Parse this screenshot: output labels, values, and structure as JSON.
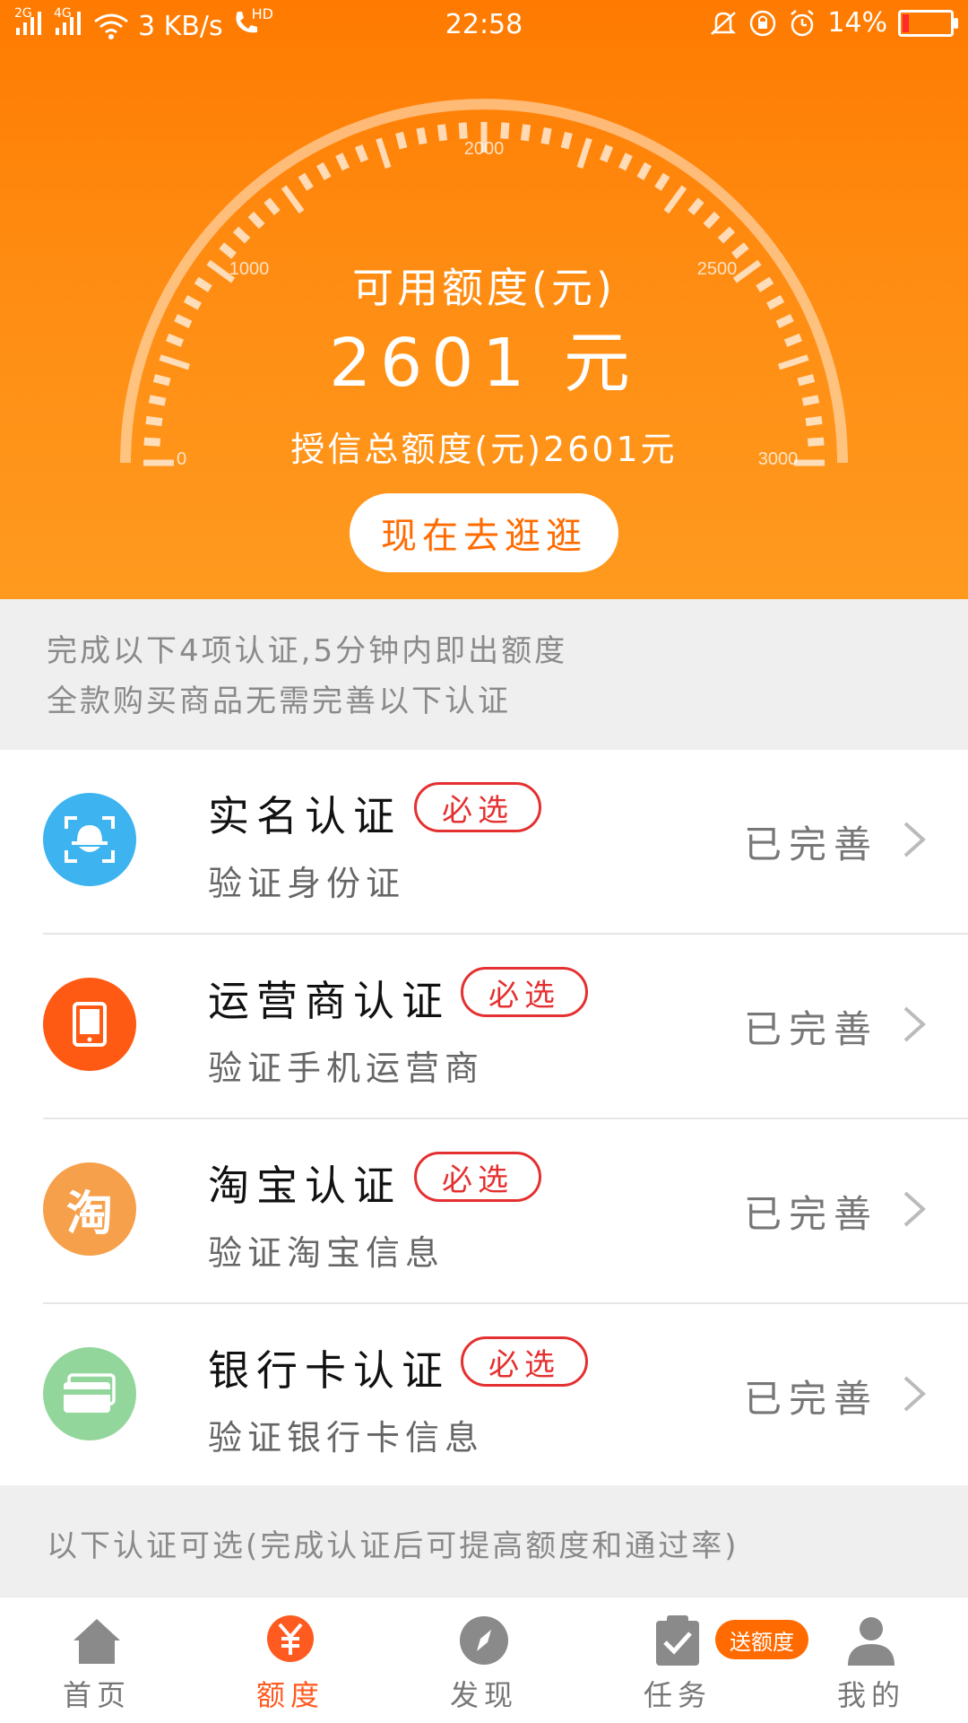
{
  "status_bar": {
    "signal_labels": [
      "2G",
      "4G"
    ],
    "net_speed": "3 KB/s",
    "hd": "HD",
    "time": "22:58",
    "battery": "14%",
    "battery_level": 0.14
  },
  "gauge": {
    "ticks": [
      "0",
      "1000",
      "2000",
      "2500",
      "3000"
    ],
    "title": "可用额度(元)",
    "amount": "2601 元",
    "total": "授信总额度(元)2601元"
  },
  "cta": {
    "label": "现在去逛逛"
  },
  "notice": {
    "line1": "完成以下4项认证,5分钟内即出额度",
    "line2": "全款购买商品无需完善以下认证"
  },
  "verifications": [
    {
      "name": "实名认证",
      "badge": "必选",
      "desc": "验证身份证",
      "status": "已完善",
      "icon": "face-id-icon",
      "color": "#3db3ef"
    },
    {
      "name": "运营商认证",
      "badge": "必选",
      "desc": "验证手机运营商",
      "status": "已完善",
      "icon": "phone-icon",
      "color": "#ff5a14"
    },
    {
      "name": "淘宝认证",
      "badge": "必选",
      "desc": "验证淘宝信息",
      "status": "已完善",
      "icon": "taobao-icon",
      "icon_text": "淘",
      "color": "#f7a04b"
    },
    {
      "name": "银行卡认证",
      "badge": "必选",
      "desc": "验证银行卡信息",
      "status": "已完善",
      "icon": "bank-card-icon",
      "color": "#92d69b"
    }
  ],
  "optional_note": "以下认证可选(完成认证后可提高额度和通过率)",
  "tabs": [
    {
      "label": "首页",
      "icon": "home-icon",
      "active": false
    },
    {
      "label": "额度",
      "icon": "quota-icon",
      "active": true
    },
    {
      "label": "发现",
      "icon": "compass-icon",
      "active": false
    },
    {
      "label": "任务",
      "icon": "task-icon",
      "active": false,
      "badge": "送额度"
    },
    {
      "label": "我的",
      "icon": "user-icon",
      "active": false
    }
  ]
}
